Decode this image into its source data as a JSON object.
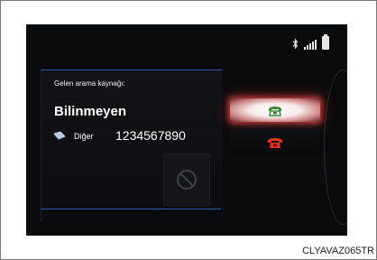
{
  "incoming_call": {
    "title": "Gelen arama kaynağı:",
    "caller_name": "Bilinmeyen",
    "phone_type": "Diğer",
    "phone_number": "1234567890"
  },
  "colors": {
    "accept": "#3a8a3a",
    "decline": "#e0302a",
    "accent_line": "#2c5aa8"
  },
  "icons": {
    "status": [
      "bluetooth-icon",
      "signal-icon",
      "battery-icon"
    ],
    "phone_type": "phone-book-icon",
    "mute": "prohibited-icon",
    "accept": "phone-handset-icon",
    "decline": "phone-hangup-icon"
  },
  "image_code": "CLYAVAZ065TR"
}
